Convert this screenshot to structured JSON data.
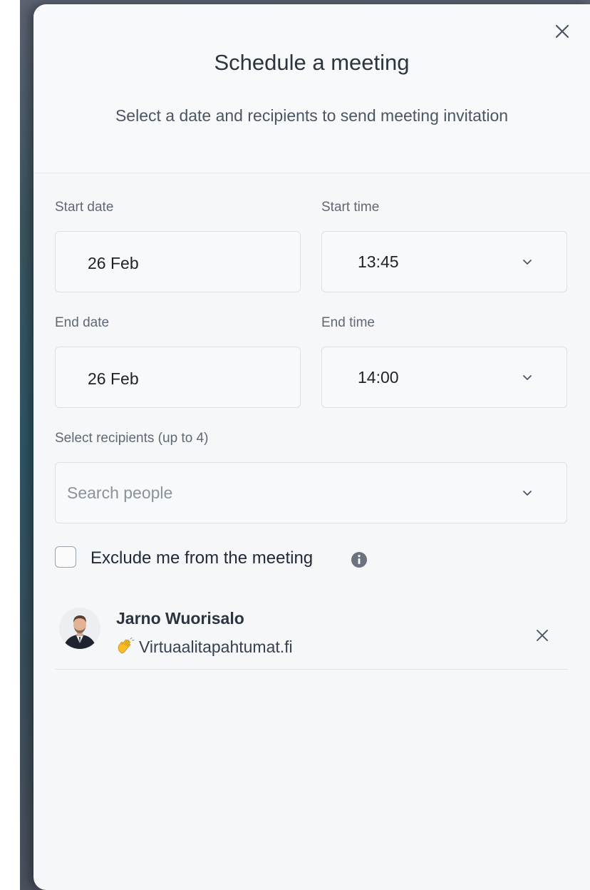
{
  "modal": {
    "title": "Schedule a meeting",
    "subtitle": "Select a date and recipients to send meeting invitation",
    "close_icon": "close-icon"
  },
  "form": {
    "start_date": {
      "label": "Start date",
      "value": "26 Feb"
    },
    "start_time": {
      "label": "Start time",
      "value": "13:45"
    },
    "end_date": {
      "label": "End date",
      "value": "26 Feb"
    },
    "end_time": {
      "label": "End time",
      "value": "14:00"
    },
    "recipients": {
      "label": "Select recipients (up to 4)",
      "placeholder": "Search people"
    },
    "exclude_me": {
      "label": "Exclude me from the meeting",
      "checked": false
    }
  },
  "selected_recipients": [
    {
      "name": "Jarno Wuorisalo",
      "organization": "Virtuaalitapahtumat.fi",
      "icon": "waving-hand-icon"
    }
  ],
  "colors": {
    "modal_background": "#f6f7f9",
    "border": "#dde0e5",
    "text": "#1f2937",
    "muted": "#5f6873"
  }
}
